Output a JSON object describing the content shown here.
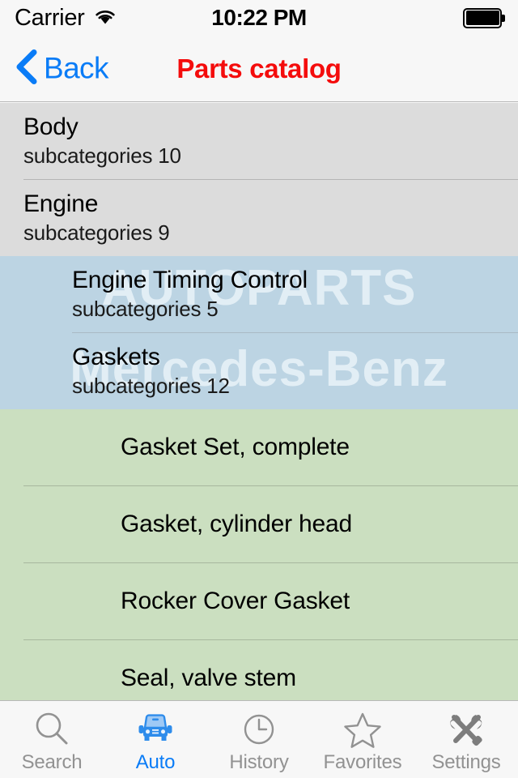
{
  "statusbar": {
    "carrier": "Carrier",
    "wifi_icon": "wifi-icon",
    "time": "10:22 PM",
    "battery_icon": "battery-full-icon"
  },
  "navbar": {
    "back_label": "Back",
    "back_icon": "chevron-left-icon",
    "title": "Parts catalog",
    "title_color": "#f40c0c",
    "back_color": "#0a7cf7"
  },
  "watermark": {
    "line1": "AUTOPARTS",
    "line2": "Mercedes-Benz"
  },
  "colors": {
    "level1_bg": "#dcdcdc",
    "level2_bg": "#bcd4e3",
    "level3_bg": "#cbdfc0",
    "accent": "#0a7cf7",
    "title_red": "#f40c0c",
    "inactive_gray": "#929292"
  },
  "list": {
    "level1": [
      {
        "title": "Body",
        "subtitle": "subcategories 10"
      },
      {
        "title": "Engine",
        "subtitle": "subcategories 9"
      }
    ],
    "level2": [
      {
        "title": "Engine Timing Control",
        "subtitle": "subcategories 5"
      },
      {
        "title": "Gaskets",
        "subtitle": "subcategories 12"
      }
    ],
    "level3": [
      {
        "title": "Gasket Set, complete"
      },
      {
        "title": "Gasket, cylinder head"
      },
      {
        "title": "Rocker Cover Gasket"
      },
      {
        "title": "Seal, valve stem"
      }
    ]
  },
  "tabbar": {
    "items": [
      {
        "label": "Search",
        "icon": "magnifier-icon",
        "selected": false
      },
      {
        "label": "Auto",
        "icon": "car-icon",
        "selected": true
      },
      {
        "label": "History",
        "icon": "clock-icon",
        "selected": false
      },
      {
        "label": "Favorites",
        "icon": "star-icon",
        "selected": false
      },
      {
        "label": "Settings",
        "icon": "tools-icon",
        "selected": false
      }
    ]
  }
}
